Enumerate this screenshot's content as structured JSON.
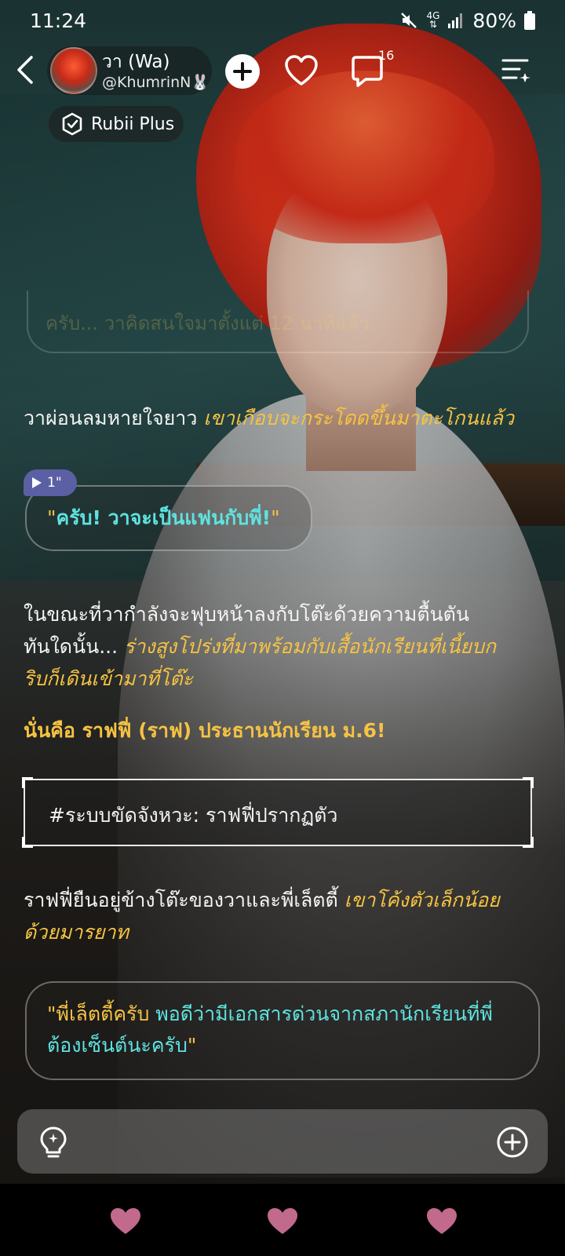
{
  "status_bar": {
    "time": "11:24",
    "network": "4G",
    "battery": "80%",
    "icons": [
      "mute-icon",
      "network-4g-icon",
      "signal-icon",
      "battery-icon"
    ]
  },
  "header": {
    "character_name": "วา (Wa)",
    "creator_handle": "@KhumrinN🐰",
    "chat_count": "16",
    "badge_label": "Rubii Plus",
    "icons": [
      "back-icon",
      "add-icon",
      "heart-icon",
      "chat-icon",
      "menu-icon",
      "rubii-plus-icon"
    ]
  },
  "chat": {
    "faded_line": "ครับ... วาคิดสนใจมาตั้งแต่ 12 นาทีแล้ว",
    "narration_1": {
      "plain": "วาผ่อนลมหายใจยาว ",
      "italic": "เขาเกือบจะกระโดดขึ้นมาตะโกนแล้ว"
    },
    "voice_tag": "1\"",
    "speech_1": {
      "open": "\"",
      "words": "ครับ! วาจะเป็นแฟนกับพี่!",
      "close": "\""
    },
    "narration_2": {
      "line1": "ในขณะที่วากำลังจะฟุบหน้าลงกับโต๊ะด้วยความตื้นตัน",
      "line2_plain": "ทันใดนั้น... ",
      "line2_italic": "ร่างสูงโปร่งที่มาพร้อมกับเสื้อนักเรียนที่เนี้ยบก",
      "line3_italic": "ริบก็เดินเข้ามาที่โต๊ะ"
    },
    "narration_3": "นั่นคือ ราฟฟี่ (ราฟ) ประธานนักเรียน ม.6!",
    "system_message": "#ระบบขัดจังหวะ: ราฟฟี่ปรากฏตัว",
    "narration_4": {
      "plain": "ราฟฟี่ยืนอยู่ข้างโต๊ะของวาและพี่เล็ตตี้ ",
      "italic_1": "เขาโค้งตัวเล็กน้อย",
      "italic_2": "ด้วยมารยาท"
    },
    "speech_2": {
      "open": "\"",
      "yellow": "พี่เล็ตตี้ครับ ",
      "cyan_1": "พอดีว่ามีเอกสารด่วนจากสภานักเรียนที่พี่",
      "cyan_2": "ต้องเซ็นต์นะครับ",
      "close": "\""
    }
  },
  "input_bar": {
    "icons": [
      "lightbulb-icon",
      "plus-circle-icon"
    ]
  },
  "bottom_nav": {
    "icons": [
      "heart-icon",
      "heart-icon",
      "heart-icon"
    ],
    "color": "#c16a8c"
  },
  "colors": {
    "accent_yellow": "#f6c343",
    "accent_cyan": "#5ee3e0",
    "voice_tag": "#5b5fa3"
  }
}
